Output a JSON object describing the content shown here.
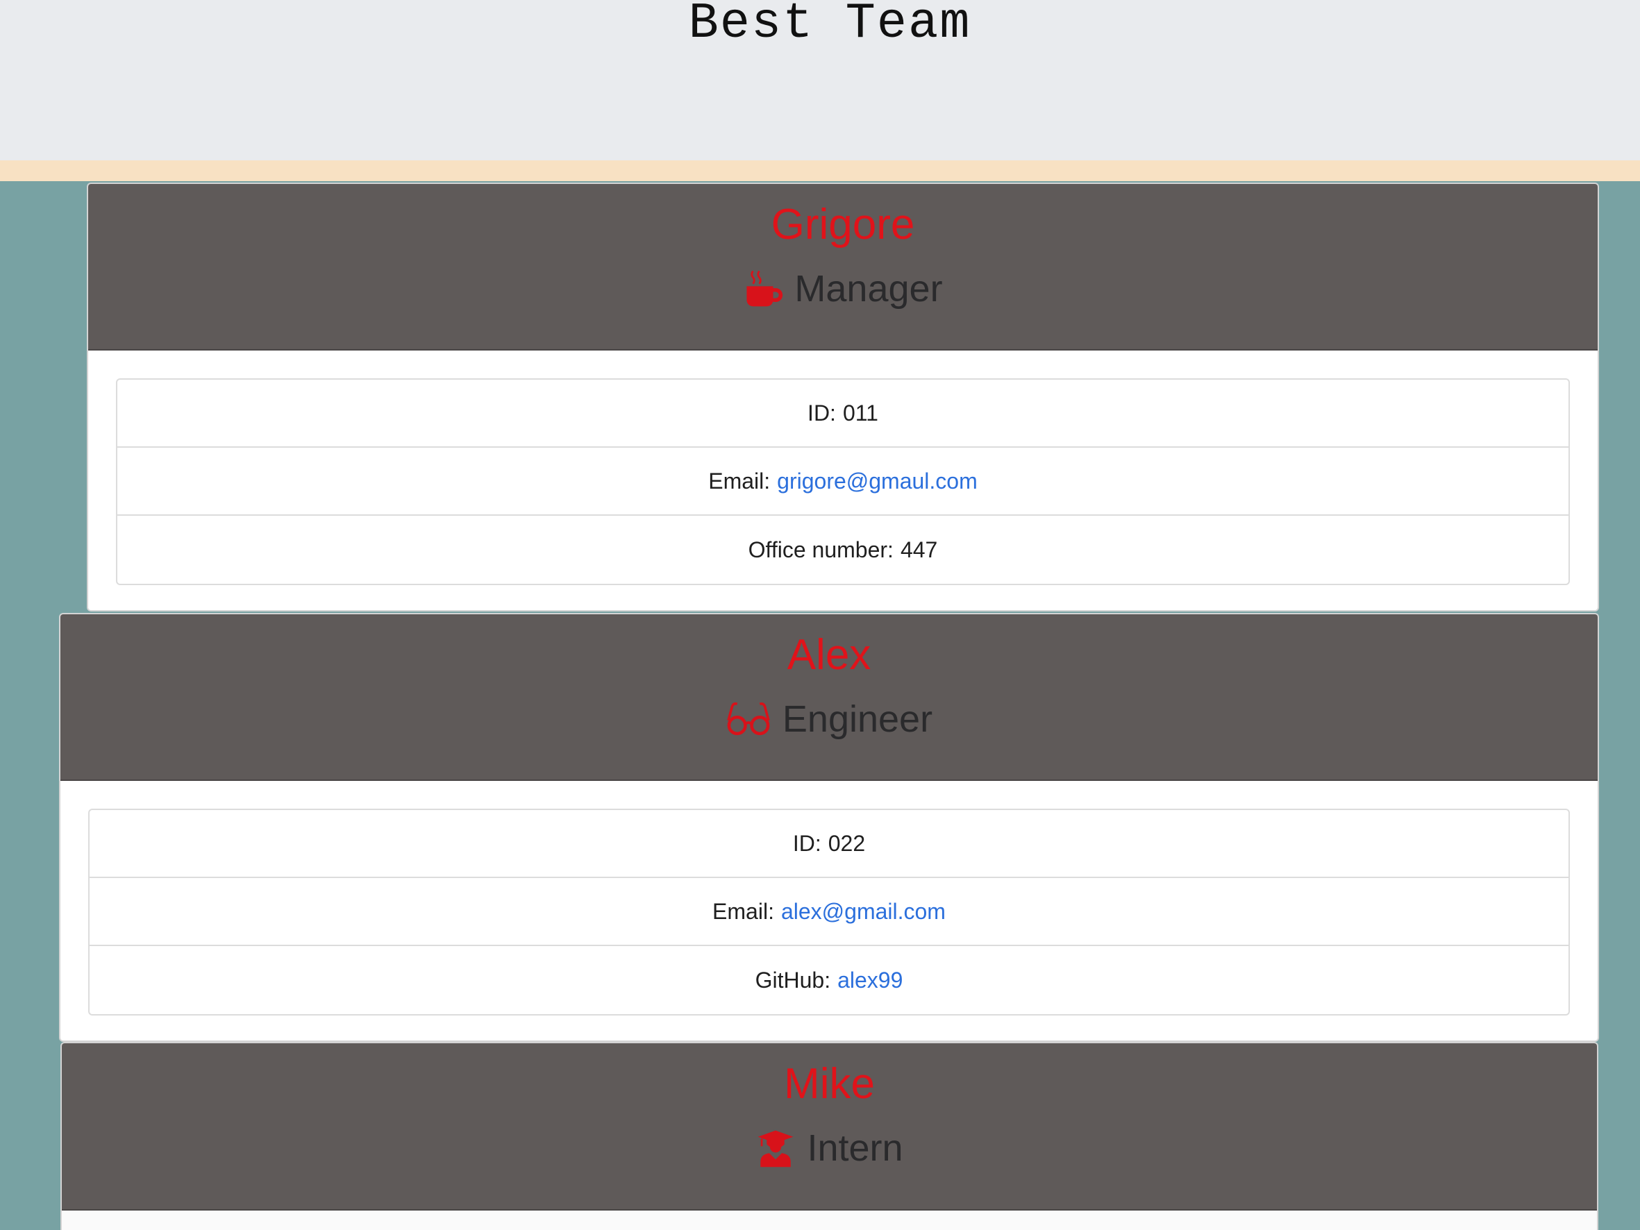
{
  "header": {
    "title": "Best Team"
  },
  "employees": [
    {
      "name": "Grigore",
      "role": "Manager",
      "role_icon": "coffee-cup-icon",
      "id_label": "ID:",
      "id": "011",
      "email_label": "Email:",
      "email": "grigore@gmaul.com",
      "extra_label": "Office number:",
      "extra_value": "447"
    },
    {
      "name": "Alex",
      "role": "Engineer",
      "role_icon": "glasses-icon",
      "id_label": "ID:",
      "id": "022",
      "email_label": "Email:",
      "email": "alex@gmail.com",
      "extra_label": "GitHub:",
      "extra_value": "alex99"
    },
    {
      "name": "Mike",
      "role": "Intern",
      "role_icon": "graduate-icon"
    }
  ],
  "colors": {
    "page_background": "#78a2a3",
    "header_background": "#e9ebee",
    "header_stripe": "#f8e1c3",
    "card_header": "#5f5a59",
    "name_color": "#e0131a",
    "role_color": "#2a2a2c",
    "link_color": "#2b6fdc"
  }
}
